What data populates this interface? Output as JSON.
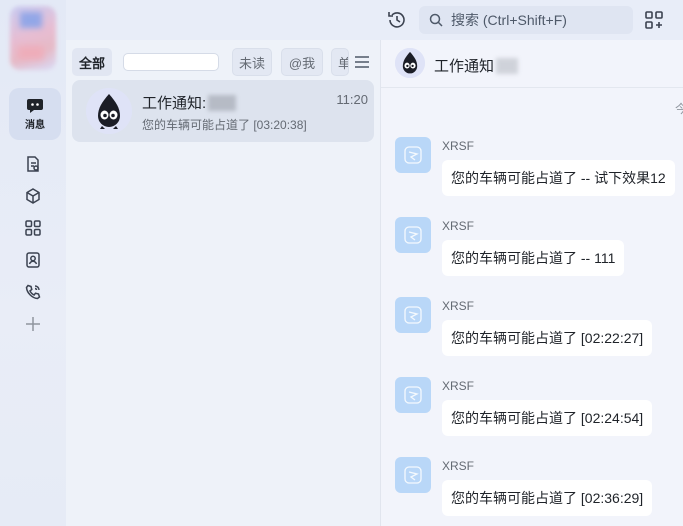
{
  "search": {
    "placeholder": "搜索 (Ctrl+Shift+F)"
  },
  "rail": {
    "active_label": "消息",
    "items": [
      "doc-icon",
      "cube-icon",
      "apps-icon",
      "contacts-icon",
      "phone-icon",
      "add-icon"
    ]
  },
  "filters": {
    "all": "全部",
    "unread": "未读",
    "mention": "@我",
    "partial": "单"
  },
  "conversation": {
    "title": "工作通知:",
    "time": "11:20",
    "preview": "您的车辆可能占道了 [03:20:38]"
  },
  "chat": {
    "title": "工作通知",
    "date_partial": "今",
    "messages": [
      {
        "sender": "XRSF",
        "text": "您的车辆可能占道了 -- 试下效果12"
      },
      {
        "sender": "XRSF",
        "text": "您的车辆可能占道了 -- 111"
      },
      {
        "sender": "XRSF",
        "text": "您的车辆可能占道了 [02:22:27]"
      },
      {
        "sender": "XRSF",
        "text": "您的车辆可能占道了 [02:24:54]"
      },
      {
        "sender": "XRSF",
        "text": "您的车辆可能占道了 [02:36:29]"
      }
    ]
  },
  "colors": {
    "accent": "#3370ff",
    "bot_avatar": "#b9d7f8"
  }
}
